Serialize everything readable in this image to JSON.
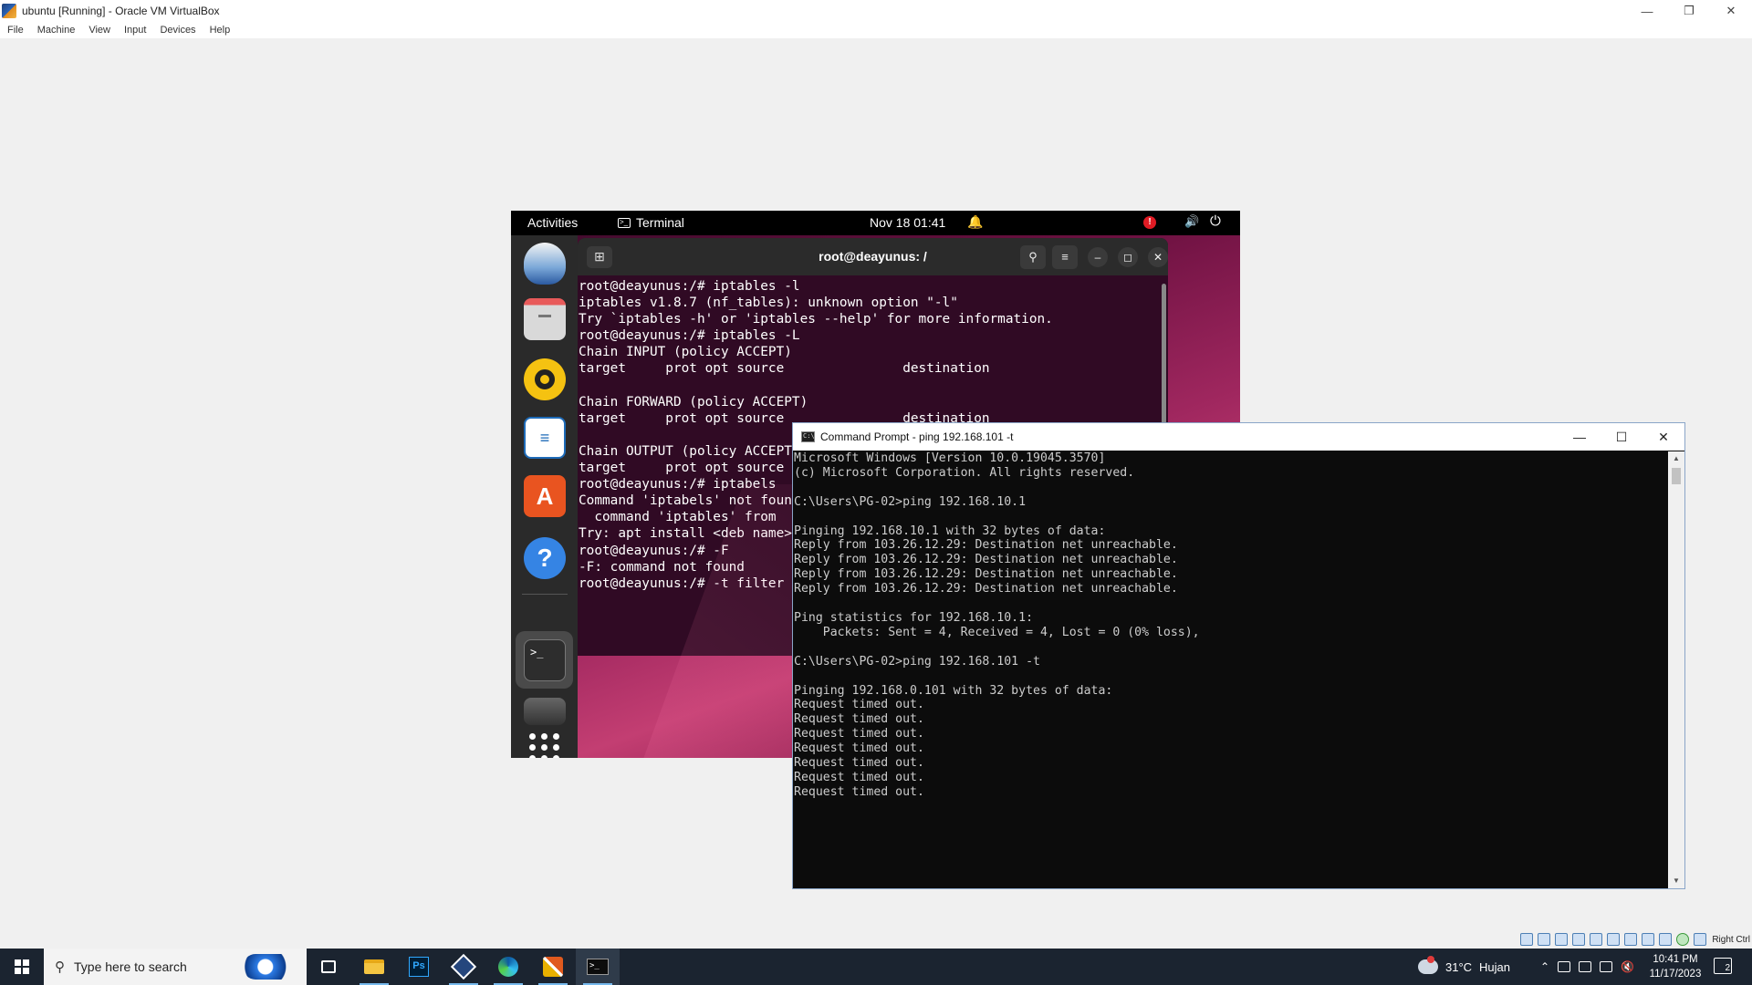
{
  "vbox": {
    "title": "ubuntu [Running] - Oracle VM VirtualBox",
    "menu": [
      "File",
      "Machine",
      "View",
      "Input",
      "Devices",
      "Help"
    ],
    "host_key": "Right Ctrl"
  },
  "ubuntu": {
    "topbar": {
      "activities": "Activities",
      "app_name": "Terminal",
      "clock": "Nov 18  01:41",
      "alert_badge": "!"
    },
    "dock": [
      "thunderbird-icon",
      "files-icon",
      "rhythmbox-icon",
      "libreoffice-writer-icon",
      "app-center-icon",
      "help-icon",
      "terminal-icon",
      "disk-icon",
      "show-apps-icon"
    ],
    "terminal": {
      "title": "root@deayunus: /",
      "lines": [
        "root@deayunus:/# iptables -l",
        "iptables v1.8.7 (nf_tables): unknown option \"-l\"",
        "Try `iptables -h' or 'iptables --help' for more information.",
        "root@deayunus:/# iptables -L",
        "Chain INPUT (policy ACCEPT)",
        "target     prot opt source               destination",
        "",
        "Chain FORWARD (policy ACCEPT)",
        "target     prot opt source               destination",
        "",
        "Chain OUTPUT (policy ACCEPT)",
        "target     prot opt source",
        "root@deayunus:/# iptabels",
        "Command 'iptabels' not found",
        "  command 'iptables' from",
        "Try: apt install <deb name>",
        "root@deayunus:/# -F",
        "-F: command not found",
        "root@deayunus:/# -t filter"
      ]
    }
  },
  "cmd": {
    "title": "Command Prompt - ping  192.168.101 -t",
    "lines": [
      "Microsoft Windows [Version 10.0.19045.3570]",
      "(c) Microsoft Corporation. All rights reserved.",
      "",
      "C:\\Users\\PG-02>ping 192.168.10.1",
      "",
      "Pinging 192.168.10.1 with 32 bytes of data:",
      "Reply from 103.26.12.29: Destination net unreachable.",
      "Reply from 103.26.12.29: Destination net unreachable.",
      "Reply from 103.26.12.29: Destination net unreachable.",
      "Reply from 103.26.12.29: Destination net unreachable.",
      "",
      "Ping statistics for 192.168.10.1:",
      "    Packets: Sent = 4, Received = 4, Lost = 0 (0% loss),",
      "",
      "C:\\Users\\PG-02>ping 192.168.101 -t",
      "",
      "Pinging 192.168.0.101 with 32 bytes of data:",
      "Request timed out.",
      "Request timed out.",
      "Request timed out.",
      "Request timed out.",
      "Request timed out.",
      "Request timed out.",
      "Request timed out."
    ]
  },
  "taskbar": {
    "search_placeholder": "Type here to search",
    "apps": [
      "task-view-icon",
      "file-explorer-icon",
      "photoshop-icon",
      "virtualbox-icon",
      "edge-icon",
      "tools-icon",
      "command-prompt-icon"
    ],
    "weather_temp": "31°C",
    "weather_text": "Hujan",
    "time": "10:41 PM",
    "date": "11/17/2023",
    "notification_count": "2"
  }
}
